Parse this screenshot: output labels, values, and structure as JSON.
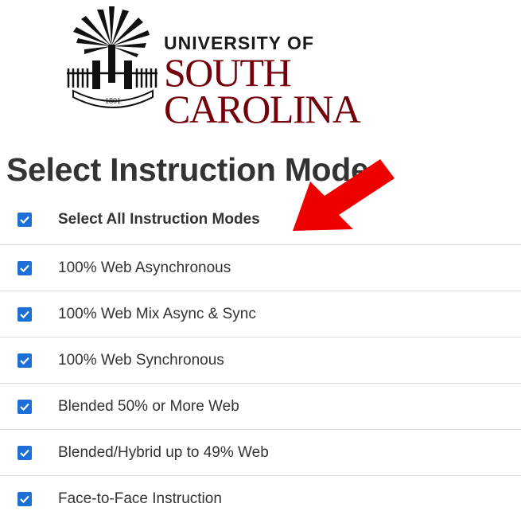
{
  "logo": {
    "line1": "UNIVERSITY OF",
    "line2": "SOUTH CAROLINA",
    "seal_year": "1801",
    "icon": "palmetto-tree-icon"
  },
  "heading": "Select Instruction Mode",
  "select_all": {
    "label": "Select All Instruction Modes",
    "checked": true
  },
  "modes": [
    {
      "label": "100% Web Asynchronous",
      "checked": true
    },
    {
      "label": "100% Web Mix Async & Sync",
      "checked": true
    },
    {
      "label": "100% Web Synchronous",
      "checked": true
    },
    {
      "label": "Blended 50% or More Web",
      "checked": true
    },
    {
      "label": "Blended/Hybrid up to 49% Web",
      "checked": true
    },
    {
      "label": "Face-to-Face Instruction",
      "checked": true
    }
  ],
  "colors": {
    "brand_garnet": "#73000a",
    "checkbox_blue": "#1b6fd6",
    "arrow_red": "#ee0000"
  }
}
